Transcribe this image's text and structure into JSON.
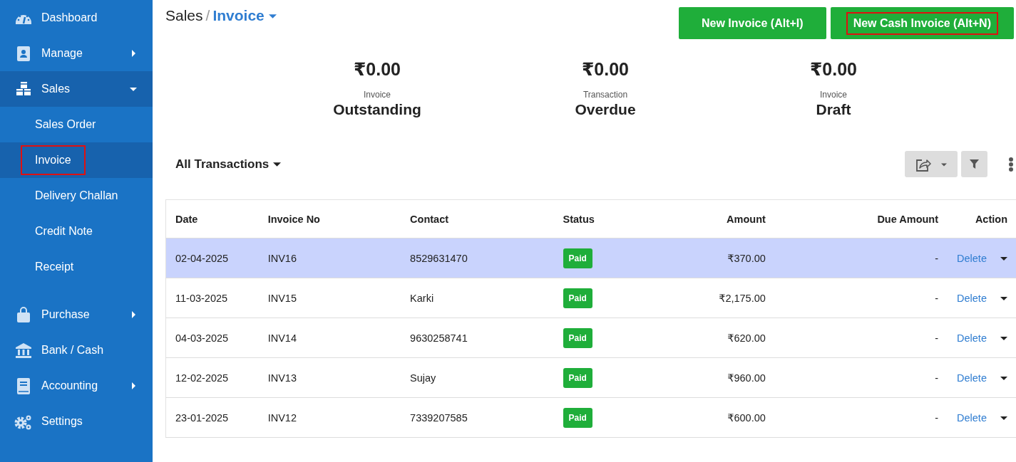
{
  "sidebar": {
    "items": [
      {
        "label": "Dashboard",
        "has_submenu": false,
        "expanded": false
      },
      {
        "label": "Manage",
        "has_submenu": true,
        "expanded": false
      },
      {
        "label": "Sales",
        "has_submenu": true,
        "expanded": true,
        "children": [
          {
            "label": "Sales Order",
            "selected": false,
            "highlighted": false
          },
          {
            "label": "Invoice",
            "selected": true,
            "highlighted": true
          },
          {
            "label": "Delivery Challan",
            "selected": false,
            "highlighted": false
          },
          {
            "label": "Credit Note",
            "selected": false,
            "highlighted": false
          },
          {
            "label": "Receipt",
            "selected": false,
            "highlighted": false
          }
        ]
      },
      {
        "label": "Purchase",
        "has_submenu": true,
        "expanded": false
      },
      {
        "label": "Bank / Cash",
        "has_submenu": false,
        "expanded": false
      },
      {
        "label": "Accounting",
        "has_submenu": true,
        "expanded": false
      },
      {
        "label": "Settings",
        "has_submenu": false,
        "expanded": false
      }
    ]
  },
  "breadcrumb": {
    "parent": "Sales",
    "separator": "/",
    "current": "Invoice"
  },
  "header_buttons": [
    {
      "label": "New Invoice (Alt+I)",
      "highlighted": false
    },
    {
      "label": "New Cash Invoice (Alt+N)",
      "highlighted": true
    }
  ],
  "summary": [
    {
      "amount": "₹0.00",
      "caption": "Invoice",
      "title": "Outstanding"
    },
    {
      "amount": "₹0.00",
      "caption": "Transaction",
      "title": "Overdue"
    },
    {
      "amount": "₹0.00",
      "caption": "Invoice",
      "title": "Draft"
    }
  ],
  "filter_dropdown": {
    "label": "All Transactions"
  },
  "table": {
    "columns": [
      "Date",
      "Invoice No",
      "Contact",
      "Status",
      "Amount",
      "Due Amount",
      "Action"
    ],
    "rows": [
      {
        "date": "02-04-2025",
        "invoice_no": "INV16",
        "contact": "8529631470",
        "status": "Paid",
        "amount": "₹370.00",
        "due_amount": "-",
        "action": "Delete",
        "selected": true
      },
      {
        "date": "11-03-2025",
        "invoice_no": "INV15",
        "contact": "Karki",
        "status": "Paid",
        "amount": "₹2,175.00",
        "due_amount": "-",
        "action": "Delete",
        "selected": false
      },
      {
        "date": "04-03-2025",
        "invoice_no": "INV14",
        "contact": "9630258741",
        "status": "Paid",
        "amount": "₹620.00",
        "due_amount": "-",
        "action": "Delete",
        "selected": false
      },
      {
        "date": "12-02-2025",
        "invoice_no": "INV13",
        "contact": "Sujay",
        "status": "Paid",
        "amount": "₹960.00",
        "due_amount": "-",
        "action": "Delete",
        "selected": false
      },
      {
        "date": "23-01-2025",
        "invoice_no": "INV12",
        "contact": "7339207585",
        "status": "Paid",
        "amount": "₹600.00",
        "due_amount": "-",
        "action": "Delete",
        "selected": false
      }
    ]
  }
}
